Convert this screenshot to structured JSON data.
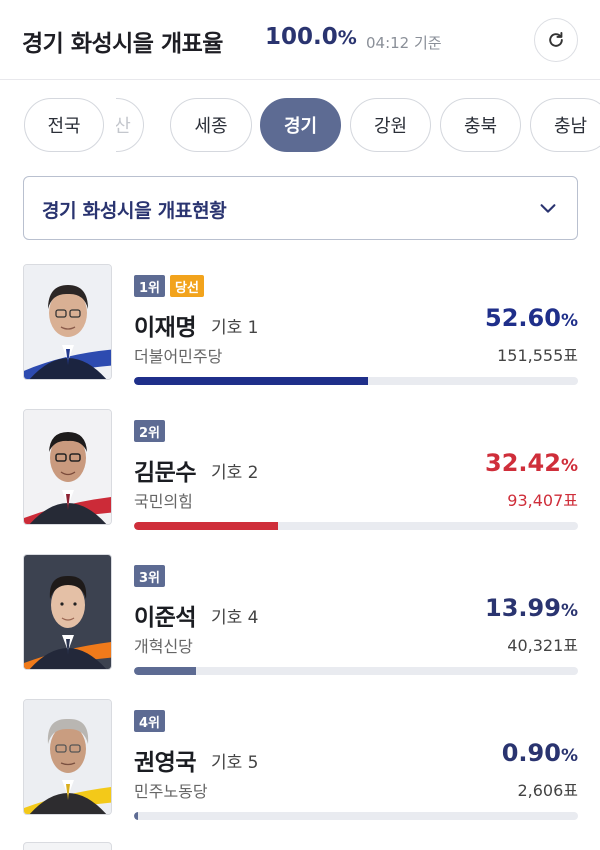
{
  "header": {
    "title": "경기 화성시을 개표율",
    "percent_value": "100.0",
    "percent_unit": "%",
    "timestamp": "04:12 기준"
  },
  "tabs": [
    {
      "label": "전국",
      "active": false
    },
    {
      "label": "산",
      "active": false
    },
    {
      "label": "세종",
      "active": false
    },
    {
      "label": "경기",
      "active": true
    },
    {
      "label": "강원",
      "active": false
    },
    {
      "label": "충북",
      "active": false
    },
    {
      "label": "충남",
      "active": false
    }
  ],
  "dropdown": {
    "label": "경기 화성시을 개표현황"
  },
  "candidates": [
    {
      "rank": "1위",
      "badge": "당선",
      "name": "이재명",
      "number": "기호 1",
      "party": "더불어민주당",
      "rate": "52.60",
      "rate_unit": "%",
      "votes": "151,555표",
      "share": 0.526,
      "color": "#1f2f8a"
    },
    {
      "rank": "2위",
      "badge": "",
      "name": "김문수",
      "number": "기호 2",
      "party": "국민의힘",
      "rate": "32.42",
      "rate_unit": "%",
      "votes": "93,407표",
      "share": 0.3242,
      "color": "#cf2e3a"
    },
    {
      "rank": "3위",
      "badge": "",
      "name": "이준석",
      "number": "기호 4",
      "party": "개혁신당",
      "rate": "13.99",
      "rate_unit": "%",
      "votes": "40,321표",
      "share": 0.1399,
      "color": "#5d6b93"
    },
    {
      "rank": "4위",
      "badge": "",
      "name": "권영국",
      "number": "기호 5",
      "party": "민주노동당",
      "rate": "0.90",
      "rate_unit": "%",
      "votes": "2,606표",
      "share": 0.009,
      "color": "#5d6b93"
    }
  ],
  "icons": {
    "refresh": "refresh-icon",
    "dropdown": "chevron-down-icon"
  },
  "colors": {
    "accent": "#5d6b93",
    "navy": "#2a3470",
    "winner": "#1f2f8a",
    "runner_up": "#cf2e3a",
    "elected_badge": "#f2a31c"
  }
}
